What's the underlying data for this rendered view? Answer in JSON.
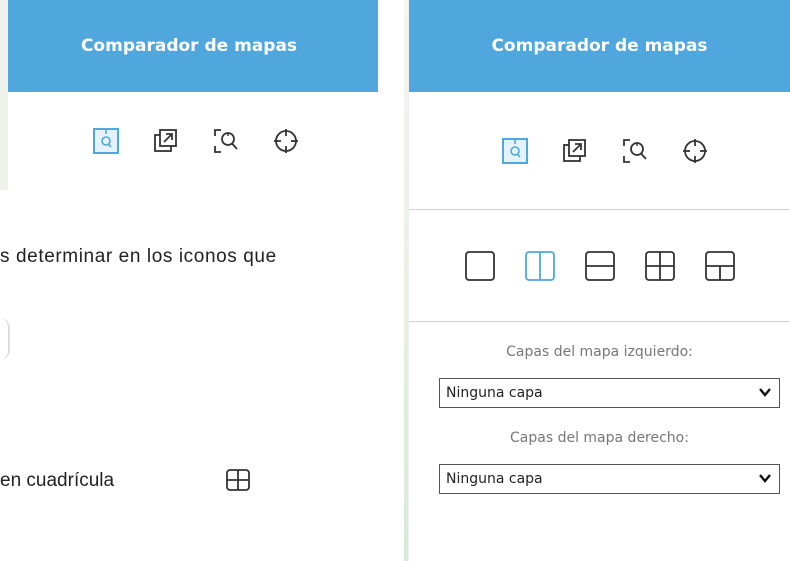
{
  "left_panel": {
    "title": "Comparador de mapas",
    "tools": [
      {
        "icon": "zoom-extent-icon",
        "active": true
      },
      {
        "icon": "open-external-icon",
        "active": false
      },
      {
        "icon": "zoom-window-icon",
        "active": false
      },
      {
        "icon": "crosshair-icon",
        "active": false
      }
    ]
  },
  "document": {
    "line1": "s determinar en los iconos que",
    "line2": "en cuadrícula"
  },
  "right_panel": {
    "title": "Comparador de mapas",
    "layouts": [
      {
        "icon": "single-view-icon",
        "active": false
      },
      {
        "icon": "vertical-split-icon",
        "active": true
      },
      {
        "icon": "horizontal-split-icon",
        "active": false
      },
      {
        "icon": "grid-four-icon",
        "active": false
      },
      {
        "icon": "three-panel-icon",
        "active": false
      }
    ],
    "left_layers_label": "Capas del mapa izquierdo:",
    "left_layers_value": "Ninguna capa",
    "right_layers_label": "Capas del mapa derecho:",
    "right_layers_value": "Ninguna capa"
  },
  "colors": {
    "header": "#4fa7de",
    "active_icon": "#4fa7de",
    "icon": "#333333"
  }
}
